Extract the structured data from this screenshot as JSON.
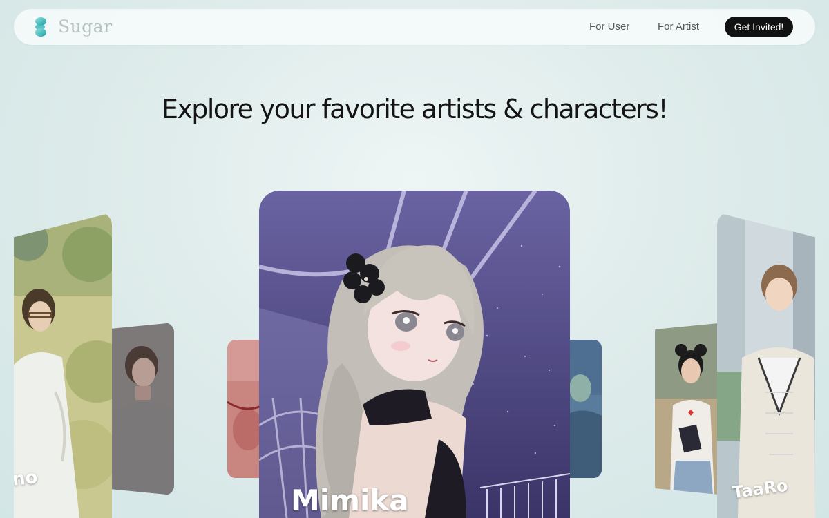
{
  "nav": {
    "logo_text": "Sugar",
    "links": [
      {
        "label": "For User"
      },
      {
        "label": "For Artist"
      }
    ],
    "cta_label": "Get Invited!"
  },
  "hero": {
    "title": "Explore your favorite artists & characters!"
  },
  "carousel": {
    "cards": [
      {
        "name": "no",
        "caption": "...",
        "image": "character-illustration-man-glasses-foliage"
      },
      {
        "name": "",
        "image": "character-illustration-dark-hair-man"
      },
      {
        "name": "",
        "image": "character-illustration-pink-hair"
      },
      {
        "name": "Mimika",
        "image": "character-illustration-silver-hair-girl-night-sky"
      },
      {
        "name": "",
        "image": "character-illustration-blue-hair"
      },
      {
        "name": "",
        "image": "character-illustration-girl-buns-holding-book"
      },
      {
        "name": "TaaRo",
        "caption": "...",
        "image": "character-illustration-brown-hair-man-sweater-vest"
      }
    ]
  },
  "colors": {
    "background": "#dfeceb",
    "accent": "#2fb3b6",
    "cta_bg": "#111111",
    "card_featured": "#5f5a8f"
  }
}
